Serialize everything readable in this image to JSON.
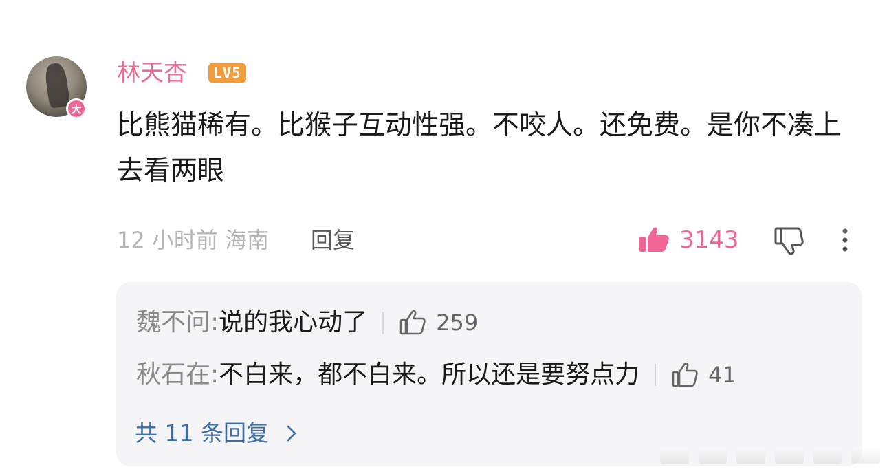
{
  "comment": {
    "username": "林天杏",
    "level": "LV5",
    "avatar_badge": "大",
    "text": "比熊猫稀有。比猴子互动性强。不咬人。还免费。是你不凑上去看两眼",
    "meta": "12 小时前 海南",
    "reply_label": "回复",
    "like_count": "3143",
    "accent_color": "#f06496",
    "username_color": "#e96c93"
  },
  "replies": [
    {
      "author": "魏不问",
      "separator": ": ",
      "text": "说的我心动了",
      "likes": "259"
    },
    {
      "author": "秋石在",
      "separator": ": ",
      "text": "不白来，都不白来。所以还是要努点力",
      "likes": "41"
    }
  ],
  "more_replies": {
    "label": "共 11 条回复",
    "color": "#3b6ea8"
  },
  "icons": {
    "like": "thumbs-up-icon",
    "dislike": "thumbs-down-icon",
    "more": "more-vertical-icon",
    "chevron": "chevron-right-icon"
  }
}
